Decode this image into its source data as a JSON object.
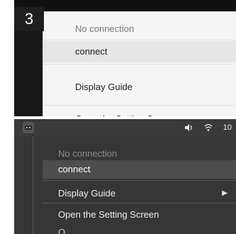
{
  "step_number": "3",
  "top_menu": {
    "items": [
      {
        "label": "No connection",
        "disabled": true
      },
      {
        "label": "connect",
        "disabled": false,
        "hover": true
      },
      {
        "label": "Display Guide",
        "disabled": false
      },
      {
        "label": "Open the Setting Screen",
        "disabled": false
      }
    ]
  },
  "mac_menubar": {
    "battery_text": "10",
    "icons": [
      "app-icon",
      "speaker-icon",
      "wifi-icon"
    ]
  },
  "mac_menu": {
    "items": [
      {
        "label": "No connection",
        "disabled": true
      },
      {
        "label": "connect",
        "disabled": false,
        "selected": true
      },
      {
        "label": "Display Guide",
        "disabled": false,
        "has_submenu": true,
        "arrow": "▶"
      },
      {
        "label": "Open the Setting Screen",
        "disabled": false
      }
    ],
    "cutoff_label": "Q..."
  },
  "colors": {
    "top_background": "#f5f5f5",
    "top_hover": "#e6e6e6",
    "mac_background": "#363636",
    "mac_selected": "#4d4d4d",
    "menubar": "#3a3a3a"
  }
}
